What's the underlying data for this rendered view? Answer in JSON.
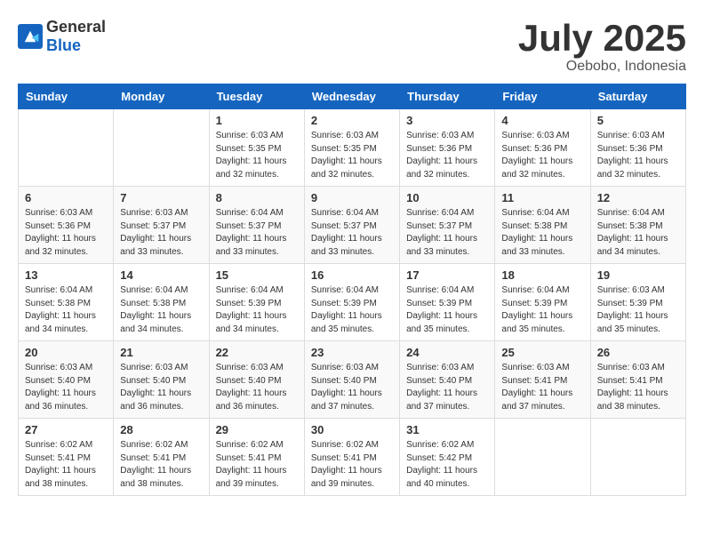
{
  "header": {
    "logo_general": "General",
    "logo_blue": "Blue",
    "title": "July 2025",
    "location": "Oebobo, Indonesia"
  },
  "weekdays": [
    "Sunday",
    "Monday",
    "Tuesday",
    "Wednesday",
    "Thursday",
    "Friday",
    "Saturday"
  ],
  "weeks": [
    [
      {
        "day": "",
        "sunrise": "",
        "sunset": "",
        "daylight": ""
      },
      {
        "day": "",
        "sunrise": "",
        "sunset": "",
        "daylight": ""
      },
      {
        "day": "1",
        "sunrise": "Sunrise: 6:03 AM",
        "sunset": "Sunset: 5:35 PM",
        "daylight": "Daylight: 11 hours and 32 minutes."
      },
      {
        "day": "2",
        "sunrise": "Sunrise: 6:03 AM",
        "sunset": "Sunset: 5:35 PM",
        "daylight": "Daylight: 11 hours and 32 minutes."
      },
      {
        "day": "3",
        "sunrise": "Sunrise: 6:03 AM",
        "sunset": "Sunset: 5:36 PM",
        "daylight": "Daylight: 11 hours and 32 minutes."
      },
      {
        "day": "4",
        "sunrise": "Sunrise: 6:03 AM",
        "sunset": "Sunset: 5:36 PM",
        "daylight": "Daylight: 11 hours and 32 minutes."
      },
      {
        "day": "5",
        "sunrise": "Sunrise: 6:03 AM",
        "sunset": "Sunset: 5:36 PM",
        "daylight": "Daylight: 11 hours and 32 minutes."
      }
    ],
    [
      {
        "day": "6",
        "sunrise": "Sunrise: 6:03 AM",
        "sunset": "Sunset: 5:36 PM",
        "daylight": "Daylight: 11 hours and 32 minutes."
      },
      {
        "day": "7",
        "sunrise": "Sunrise: 6:03 AM",
        "sunset": "Sunset: 5:37 PM",
        "daylight": "Daylight: 11 hours and 33 minutes."
      },
      {
        "day": "8",
        "sunrise": "Sunrise: 6:04 AM",
        "sunset": "Sunset: 5:37 PM",
        "daylight": "Daylight: 11 hours and 33 minutes."
      },
      {
        "day": "9",
        "sunrise": "Sunrise: 6:04 AM",
        "sunset": "Sunset: 5:37 PM",
        "daylight": "Daylight: 11 hours and 33 minutes."
      },
      {
        "day": "10",
        "sunrise": "Sunrise: 6:04 AM",
        "sunset": "Sunset: 5:37 PM",
        "daylight": "Daylight: 11 hours and 33 minutes."
      },
      {
        "day": "11",
        "sunrise": "Sunrise: 6:04 AM",
        "sunset": "Sunset: 5:38 PM",
        "daylight": "Daylight: 11 hours and 33 minutes."
      },
      {
        "day": "12",
        "sunrise": "Sunrise: 6:04 AM",
        "sunset": "Sunset: 5:38 PM",
        "daylight": "Daylight: 11 hours and 34 minutes."
      }
    ],
    [
      {
        "day": "13",
        "sunrise": "Sunrise: 6:04 AM",
        "sunset": "Sunset: 5:38 PM",
        "daylight": "Daylight: 11 hours and 34 minutes."
      },
      {
        "day": "14",
        "sunrise": "Sunrise: 6:04 AM",
        "sunset": "Sunset: 5:38 PM",
        "daylight": "Daylight: 11 hours and 34 minutes."
      },
      {
        "day": "15",
        "sunrise": "Sunrise: 6:04 AM",
        "sunset": "Sunset: 5:39 PM",
        "daylight": "Daylight: 11 hours and 34 minutes."
      },
      {
        "day": "16",
        "sunrise": "Sunrise: 6:04 AM",
        "sunset": "Sunset: 5:39 PM",
        "daylight": "Daylight: 11 hours and 35 minutes."
      },
      {
        "day": "17",
        "sunrise": "Sunrise: 6:04 AM",
        "sunset": "Sunset: 5:39 PM",
        "daylight": "Daylight: 11 hours and 35 minutes."
      },
      {
        "day": "18",
        "sunrise": "Sunrise: 6:04 AM",
        "sunset": "Sunset: 5:39 PM",
        "daylight": "Daylight: 11 hours and 35 minutes."
      },
      {
        "day": "19",
        "sunrise": "Sunrise: 6:03 AM",
        "sunset": "Sunset: 5:39 PM",
        "daylight": "Daylight: 11 hours and 35 minutes."
      }
    ],
    [
      {
        "day": "20",
        "sunrise": "Sunrise: 6:03 AM",
        "sunset": "Sunset: 5:40 PM",
        "daylight": "Daylight: 11 hours and 36 minutes."
      },
      {
        "day": "21",
        "sunrise": "Sunrise: 6:03 AM",
        "sunset": "Sunset: 5:40 PM",
        "daylight": "Daylight: 11 hours and 36 minutes."
      },
      {
        "day": "22",
        "sunrise": "Sunrise: 6:03 AM",
        "sunset": "Sunset: 5:40 PM",
        "daylight": "Daylight: 11 hours and 36 minutes."
      },
      {
        "day": "23",
        "sunrise": "Sunrise: 6:03 AM",
        "sunset": "Sunset: 5:40 PM",
        "daylight": "Daylight: 11 hours and 37 minutes."
      },
      {
        "day": "24",
        "sunrise": "Sunrise: 6:03 AM",
        "sunset": "Sunset: 5:40 PM",
        "daylight": "Daylight: 11 hours and 37 minutes."
      },
      {
        "day": "25",
        "sunrise": "Sunrise: 6:03 AM",
        "sunset": "Sunset: 5:41 PM",
        "daylight": "Daylight: 11 hours and 37 minutes."
      },
      {
        "day": "26",
        "sunrise": "Sunrise: 6:03 AM",
        "sunset": "Sunset: 5:41 PM",
        "daylight": "Daylight: 11 hours and 38 minutes."
      }
    ],
    [
      {
        "day": "27",
        "sunrise": "Sunrise: 6:02 AM",
        "sunset": "Sunset: 5:41 PM",
        "daylight": "Daylight: 11 hours and 38 minutes."
      },
      {
        "day": "28",
        "sunrise": "Sunrise: 6:02 AM",
        "sunset": "Sunset: 5:41 PM",
        "daylight": "Daylight: 11 hours and 38 minutes."
      },
      {
        "day": "29",
        "sunrise": "Sunrise: 6:02 AM",
        "sunset": "Sunset: 5:41 PM",
        "daylight": "Daylight: 11 hours and 39 minutes."
      },
      {
        "day": "30",
        "sunrise": "Sunrise: 6:02 AM",
        "sunset": "Sunset: 5:41 PM",
        "daylight": "Daylight: 11 hours and 39 minutes."
      },
      {
        "day": "31",
        "sunrise": "Sunrise: 6:02 AM",
        "sunset": "Sunset: 5:42 PM",
        "daylight": "Daylight: 11 hours and 40 minutes."
      },
      {
        "day": "",
        "sunrise": "",
        "sunset": "",
        "daylight": ""
      },
      {
        "day": "",
        "sunrise": "",
        "sunset": "",
        "daylight": ""
      }
    ]
  ]
}
